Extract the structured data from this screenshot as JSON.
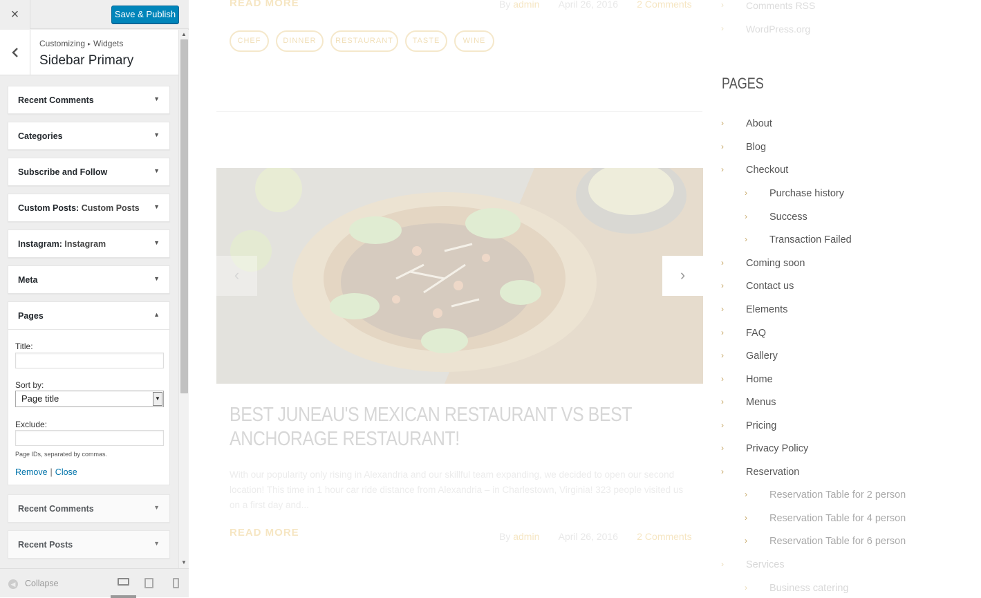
{
  "panel": {
    "close_icon": "×",
    "save_label": "Save & Publish",
    "breadcrumb": [
      "Customizing",
      "Widgets"
    ],
    "section_title": "Sidebar Primary",
    "widgets": [
      {
        "title": "Recent Comments",
        "subtitle": ""
      },
      {
        "title": "Categories",
        "subtitle": ""
      },
      {
        "title": "Subscribe and Follow",
        "subtitle": ""
      },
      {
        "title": "Custom Posts:",
        "subtitle": "Custom Posts"
      },
      {
        "title": "Instagram:",
        "subtitle": "Instagram"
      },
      {
        "title": "Meta",
        "subtitle": ""
      },
      {
        "title": "Pages",
        "subtitle": ""
      },
      {
        "title": "Recent Comments",
        "subtitle": ""
      },
      {
        "title": "Recent Posts",
        "subtitle": ""
      }
    ],
    "pages_form": {
      "title_label": "Title:",
      "title_value": "",
      "sortby_label": "Sort by:",
      "sortby_value": "Page title",
      "exclude_label": "Exclude:",
      "exclude_value": "",
      "help_text": "Page IDs, separated by commas.",
      "remove_label": "Remove",
      "separator": "|",
      "close_label": "Close"
    },
    "footer": {
      "collapse_label": "Collapse"
    }
  },
  "preview": {
    "top_meta": {
      "readmore": "READ MORE",
      "by": "By",
      "author": "admin",
      "date": "April 26, 2016",
      "comments": "2 Comments"
    },
    "tags": [
      "CHEF",
      "DINNER",
      "RESTAURANT",
      "TASTE",
      "WINE"
    ],
    "post": {
      "title": "BEST JUNEAU'S MEXICAN RESTAURANT VS BEST ANCHORAGE RESTAURANT!",
      "excerpt": "With our popularity only rising in Alexandria and our skillful team expanding, we decided to open our second location! This time in 1 hour car ride distance from Alexandria – in Charlestown, Virginia! 323 people visited us on a first day and...",
      "readmore": "READ MORE",
      "by": "By",
      "author": "admin",
      "date": "April 26, 2016",
      "comments": "2 Comments"
    },
    "sidebar_top_links": [
      "Comments RSS",
      "WordPress.org"
    ],
    "pages_heading": "PAGES",
    "pages": [
      {
        "label": "About",
        "level": 1
      },
      {
        "label": "Blog",
        "level": 1
      },
      {
        "label": "Checkout",
        "level": 1
      },
      {
        "label": "Purchase history",
        "level": 2
      },
      {
        "label": "Success",
        "level": 2
      },
      {
        "label": "Transaction Failed",
        "level": 2
      },
      {
        "label": "Coming soon",
        "level": 1
      },
      {
        "label": "Contact us",
        "level": 1
      },
      {
        "label": "Elements",
        "level": 1
      },
      {
        "label": "FAQ",
        "level": 1
      },
      {
        "label": "Gallery",
        "level": 1
      },
      {
        "label": "Home",
        "level": 1
      },
      {
        "label": "Menus",
        "level": 1
      },
      {
        "label": "Pricing",
        "level": 1
      },
      {
        "label": "Privacy Policy",
        "level": 1
      },
      {
        "label": "Reservation",
        "level": 1
      },
      {
        "label": "Reservation Table for 2 person",
        "level": 2
      },
      {
        "label": "Reservation Table for 4 person",
        "level": 2
      },
      {
        "label": "Reservation Table for 6 person",
        "level": 2
      },
      {
        "label": "Services",
        "level": 1
      },
      {
        "label": "Business catering",
        "level": 2
      }
    ]
  },
  "colors": {
    "accent": "#0085ba",
    "link": "#0073aa",
    "gold": "#c8a96a"
  }
}
